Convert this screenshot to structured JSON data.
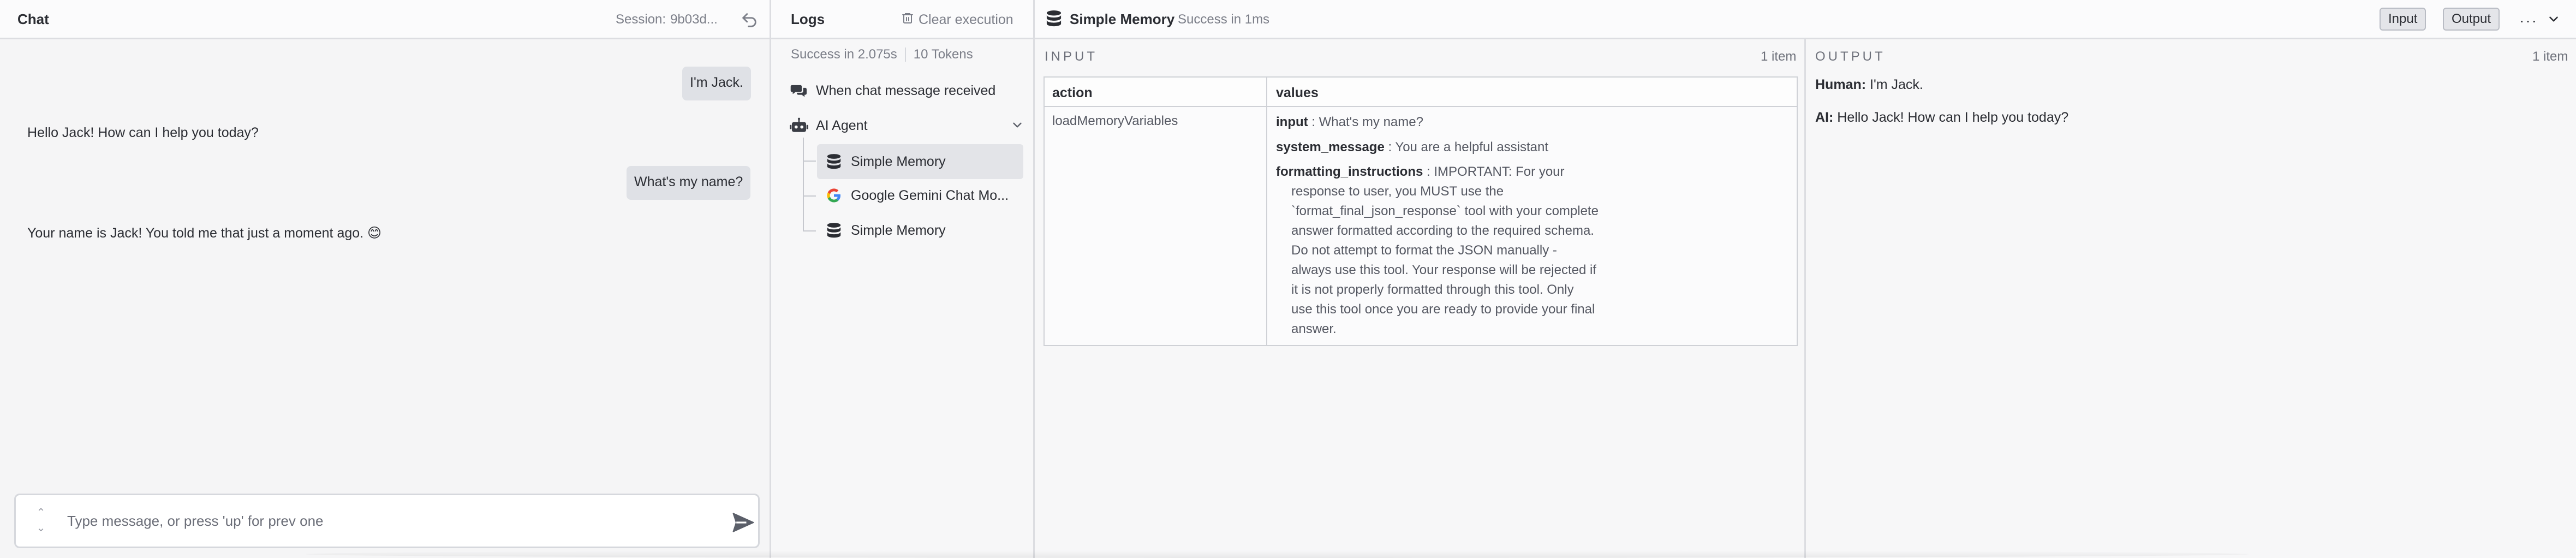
{
  "chat": {
    "title": "Chat",
    "session_label": "Session:",
    "session_value": "9b03d...",
    "messages": [
      {
        "role": "user",
        "text": "I'm Jack."
      },
      {
        "role": "bot",
        "text": "Hello Jack! How can I help you today?"
      },
      {
        "role": "user",
        "text": "What's my name?"
      },
      {
        "role": "bot",
        "text": "Your name is Jack! You told me that just a moment ago. 😊"
      }
    ],
    "input": {
      "placeholder": "Type message, or press 'up' for prev one",
      "value": ""
    }
  },
  "logs": {
    "title": "Logs",
    "clear_label": "Clear execution",
    "summary": {
      "success": "Success in 2.075s",
      "tokens": "10 Tokens"
    },
    "items": [
      {
        "label": "When chat message received",
        "icon": "chat-bubbles-icon"
      },
      {
        "label": "AI Agent",
        "icon": "robot-icon"
      },
      {
        "label": "Simple Memory",
        "icon": "database-icon",
        "selected": true
      },
      {
        "label": "Google Gemini Chat Mo...",
        "icon": "google-icon"
      },
      {
        "label": "Simple Memory",
        "icon": "database-icon"
      }
    ]
  },
  "detail": {
    "title": "Simple Memory",
    "status": "Success in 1ms",
    "input_btn": "Input",
    "output_btn": "Output",
    "more": "···",
    "input": {
      "label": "INPUT",
      "count": "1 item",
      "col_action": "action",
      "col_values": "values",
      "action_value": "loadMemoryVariables",
      "rows": [
        {
          "key": "input",
          "value": "What's my name?"
        },
        {
          "key": "system_message",
          "value": "You are a helpful assistant"
        },
        {
          "key": "formatting_instructions",
          "value_first": "IMPORTANT: For your",
          "value_lines": [
            "response to user, you MUST use the",
            "`format_final_json_response` tool with your complete",
            "answer formatted according to the required schema.",
            "Do not attempt to format the JSON manually -",
            "always use this tool. Your response will be rejected if",
            "it is not properly formatted through this tool. Only",
            "use this tool once you are ready to provide your final",
            "answer."
          ]
        }
      ]
    },
    "output": {
      "label": "OUTPUT",
      "count": "1 item",
      "lines": [
        {
          "speaker": "Human:",
          "text": "I'm Jack."
        },
        {
          "speaker": "AI:",
          "text": "Hello Jack! How can I help you today?"
        }
      ]
    }
  }
}
